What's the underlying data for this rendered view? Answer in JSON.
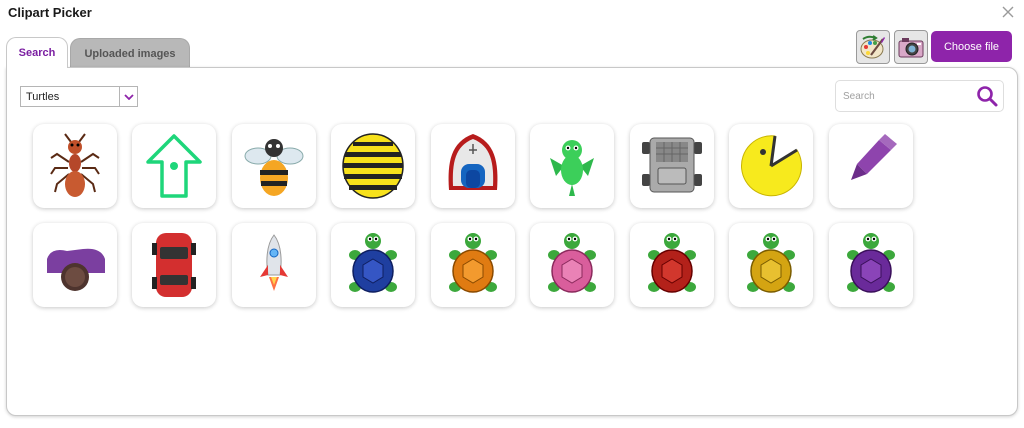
{
  "window": {
    "title": "Clipart Picker"
  },
  "tabs": {
    "search": "Search",
    "uploaded": "Uploaded images"
  },
  "toolbar": {
    "choose_file": "Choose file",
    "paint_icon": "paint-palette-icon",
    "camera_icon": "camera-icon"
  },
  "filter": {
    "category": "Turtles",
    "options": [
      "Turtles"
    ]
  },
  "search": {
    "placeholder": "Search",
    "value": ""
  },
  "colors": {
    "accent": "#8e24aa",
    "tab_active_text": "#7b1fa2",
    "tab_inactive_bg": "#b8b8b8"
  },
  "clipart": [
    {
      "name": "ant"
    },
    {
      "name": "arrow"
    },
    {
      "name": "bee"
    },
    {
      "name": "beebot"
    },
    {
      "name": "boat"
    },
    {
      "name": "dragon"
    },
    {
      "name": "rover"
    },
    {
      "name": "pacman"
    },
    {
      "name": "pen"
    },
    {
      "name": "person"
    },
    {
      "name": "car"
    },
    {
      "name": "rocket"
    },
    {
      "name": "turtle-blue"
    },
    {
      "name": "turtle-orange"
    },
    {
      "name": "turtle-pink"
    },
    {
      "name": "turtle-red"
    },
    {
      "name": "turtle-yellow"
    },
    {
      "name": "turtle-purple"
    }
  ]
}
